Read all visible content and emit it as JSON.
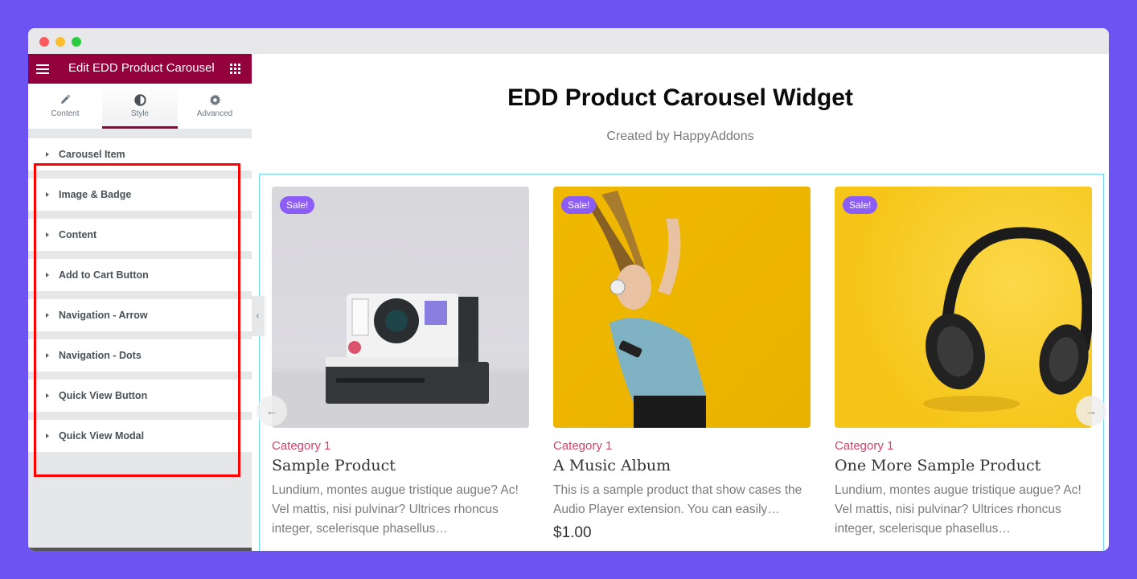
{
  "window": {
    "controls": [
      "close",
      "minimize",
      "maximize"
    ]
  },
  "sidebar": {
    "title": "Edit EDD Product Carousel",
    "menu_icon": "hamburger-icon",
    "apps_icon": "grid-icon",
    "tabs": [
      {
        "label": "Content",
        "icon": "pencil-icon",
        "active": false
      },
      {
        "label": "Style",
        "icon": "contrast-icon",
        "active": true
      },
      {
        "label": "Advanced",
        "icon": "gear-icon",
        "active": false
      }
    ],
    "sections": [
      {
        "label": "Carousel Item"
      },
      {
        "label": "Image & Badge"
      },
      {
        "label": "Content"
      },
      {
        "label": "Add to Cart Button"
      },
      {
        "label": "Navigation - Arrow"
      },
      {
        "label": "Navigation - Dots"
      },
      {
        "label": "Quick View Button"
      },
      {
        "label": "Quick View Modal"
      }
    ],
    "collapse_icon": "chevron-left-icon"
  },
  "main": {
    "title": "EDD Product Carousel Widget",
    "subtitle": "Created by HappyAddons",
    "products": [
      {
        "badge": "Sale!",
        "category": "Category 1",
        "name": "Sample Product",
        "description": "Lundium, montes augue tristique augue? Ac! Vel mattis, nisi pulvinar? Ultrices rhoncus integer, scelerisque phasellus…",
        "price": "",
        "image": "polaroid-camera"
      },
      {
        "badge": "Sale!",
        "category": "Category 1",
        "name": "A Music Album",
        "description": "This is a sample product that show cases the Audio Player extension. You can easily…",
        "price": "$1.00",
        "image": "woman-with-headphones"
      },
      {
        "badge": "Sale!",
        "category": "Category 1",
        "name": "One More Sample Product",
        "description": "Lundium, montes augue tristique augue? Ac! Vel mattis, nisi pulvinar? Ultrices rhoncus integer, scelerisque phasellus…",
        "price": "",
        "image": "black-headphones"
      }
    ],
    "prev_arrow": "←",
    "next_arrow": "→"
  },
  "colors": {
    "background": "#6c53f2",
    "header": "#93003c",
    "badge": "#8b5cf6",
    "category": "#d0436c",
    "highlight": "#ff0000",
    "carousel_border": "#71d7f7"
  }
}
